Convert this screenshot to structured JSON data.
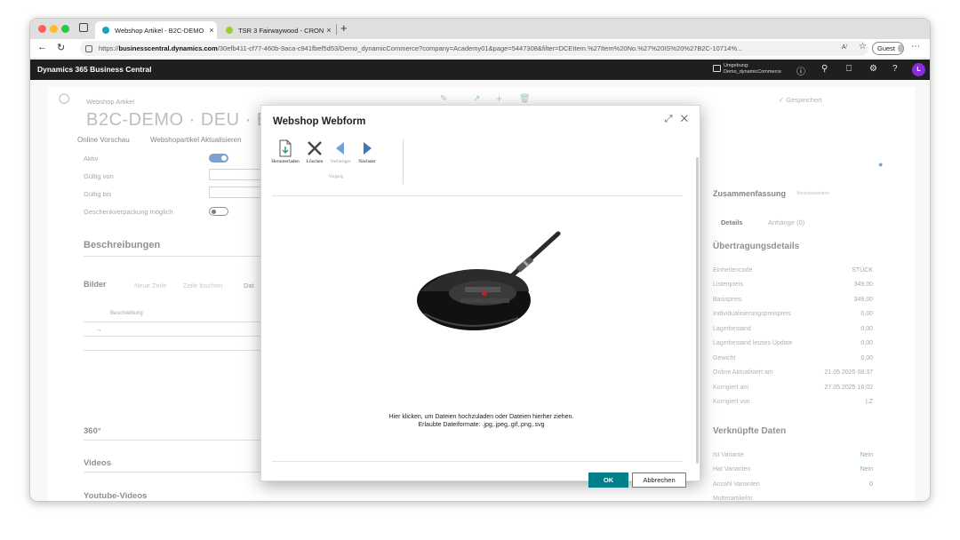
{
  "browser": {
    "tabs": [
      {
        "title": "Webshop Artikel - B2C-DEMO",
        "close": "×"
      },
      {
        "title": "TSR 3 Fairwaywood - CRONUS",
        "close": "×"
      }
    ],
    "new_tab": "+",
    "url_prefix": "https://",
    "url_host": "businesscentral.dynamics.com",
    "url_rest": "/30efb411-cf77-460b-9aca-c941fbef5d53/Demo_dynamicCommerce?company=Academy01&page=5447308&filter=DCEItem.%27Item%20No.%27%20IS%20%27B2C-10714%...",
    "guest_label": "Guest",
    "read_aloud": "A⁾",
    "more": "⋯"
  },
  "bc_header": {
    "app_name": "Dynamics 365 Business Central",
    "env_label": "Umgebung:",
    "env_name": "Demo_dynamicCommerce",
    "user_initial": "L"
  },
  "background_page": {
    "breadcrumb": "Webshop Artikel",
    "title": "B2C-DEMO · DEU · B2C-107",
    "saved_label": "✓ Gespeichert",
    "actions": {
      "online_preview": "Online Vorschau",
      "update": "Webshopartikel Aktualisieren"
    },
    "fields": [
      {
        "label": "Aktiv"
      },
      {
        "label": "Gültig von"
      },
      {
        "label": "Gültig bis"
      },
      {
        "label": "Geschenkverpackung möglich"
      }
    ],
    "sections": {
      "descriptions": "Beschreibungen",
      "images": "Bilder",
      "images_new_line": "Neue Zeile",
      "images_delete_line": "Zeile löschen",
      "images_col": "Beschreibung",
      "images_dat": "Dat",
      "view360": "360°",
      "videos": "Videos",
      "youtube": "Youtube-Videos"
    },
    "factbox": {
      "summary_title": "Zusammenfassung",
      "summary_badge": "Vorschauversion",
      "tab_details": "Details",
      "tab_attachments": "Anhänge (0)",
      "transfer_title": "Übertragungsdetails",
      "rows": [
        {
          "label": "Einheitencode",
          "value": "STÜCK"
        },
        {
          "label": "Listenpreis",
          "value": "349,00"
        },
        {
          "label": "Basispreis",
          "value": "349,00"
        },
        {
          "label": "Individualisierungspreispreis",
          "value": "0,00"
        },
        {
          "label": "Lagerbestand",
          "value": "0,00"
        },
        {
          "label": "Lagerbestand letztes Update",
          "value": "0,00"
        },
        {
          "label": "Gewicht",
          "value": "0,00"
        },
        {
          "label": "Online Aktualisiert am",
          "value": "21.05.2025 08:37"
        },
        {
          "label": "Korrigiert am",
          "value": "27.05.2025 16:02"
        },
        {
          "label": "Korrigiert von",
          "value": "LZ"
        }
      ],
      "linked_title": "Verknüpfte Daten",
      "linked_rows": [
        {
          "label": "Ist Variante",
          "value": "Nein"
        },
        {
          "label": "Hat Varianten",
          "value": "Nein"
        },
        {
          "label": "Anzahl Varianten",
          "value": "0"
        },
        {
          "label": "Mutterartikelnr.",
          "value": "_"
        },
        {
          "label": "Anzahl Kategorien",
          "value": "2"
        }
      ]
    }
  },
  "modal": {
    "title": "Webshop Webform",
    "ribbon": {
      "download": "Herunterladen",
      "delete": "Löschen",
      "previous": "Vorheriger",
      "next": "Nächster",
      "group": "Vorgang"
    },
    "hint_line1": "Hier klicken, um Dateien hochzuladen oder Dateien hierher ziehen.",
    "hint_line2": "Erlaubte Dateiformate: .jpg,.jpeg,.gif,.png,.svg",
    "ok_label": "OK",
    "cancel_label": "Abbrechen"
  },
  "colors": {
    "accent": "#00808a",
    "bc_header": "#1f1f1f",
    "toggle_on": "#3b6fb6",
    "link_green": "#2f8f4f",
    "user_badge": "#8a2be2"
  },
  "icons": [
    "back-icon",
    "reload-icon",
    "lock-icon",
    "tab-overview-icon",
    "edit-icon",
    "share-icon",
    "add-icon",
    "delete-icon",
    "expand-icon",
    "close-icon",
    "download-icon",
    "previous-arrow-icon",
    "next-arrow-icon",
    "gear-icon",
    "bell-icon",
    "search-icon",
    "help-icon"
  ]
}
